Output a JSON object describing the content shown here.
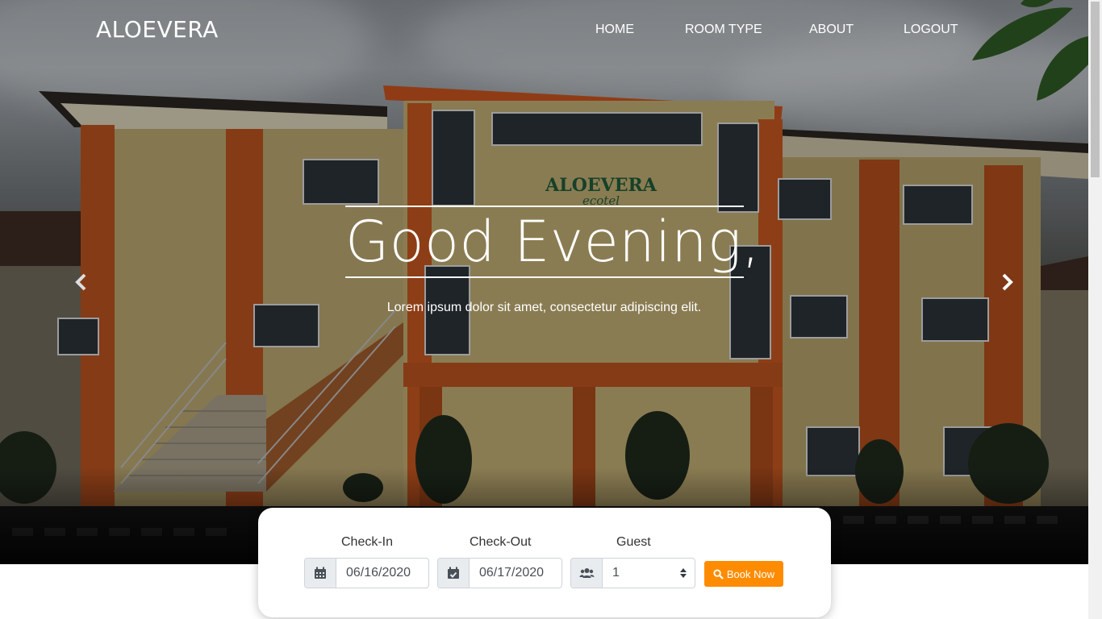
{
  "brand": "ALOEVERA",
  "nav": {
    "items": [
      {
        "label": "HOME"
      },
      {
        "label": "ROOM TYPE"
      },
      {
        "label": "ABOUT"
      },
      {
        "label": "LOGOUT"
      }
    ]
  },
  "hero": {
    "greeting": "Good Evening,",
    "subtitle": "Lorem ipsum dolor sit amet, consectetur adipiscing elit.",
    "controls": {
      "prev_icon": "chevron-left-icon",
      "next_icon": "chevron-right-icon"
    }
  },
  "booking": {
    "checkin": {
      "label": "Check-In",
      "value": "06/16/2020",
      "icon": "calendar-icon"
    },
    "checkout": {
      "label": "Check-Out",
      "value": "06/17/2020",
      "icon": "calendar-check-icon"
    },
    "guest": {
      "label": "Guest",
      "value": "1",
      "icon": "users-icon"
    },
    "button": {
      "label": "Book Now",
      "icon": "search-icon",
      "color": "#ff8c00"
    }
  }
}
